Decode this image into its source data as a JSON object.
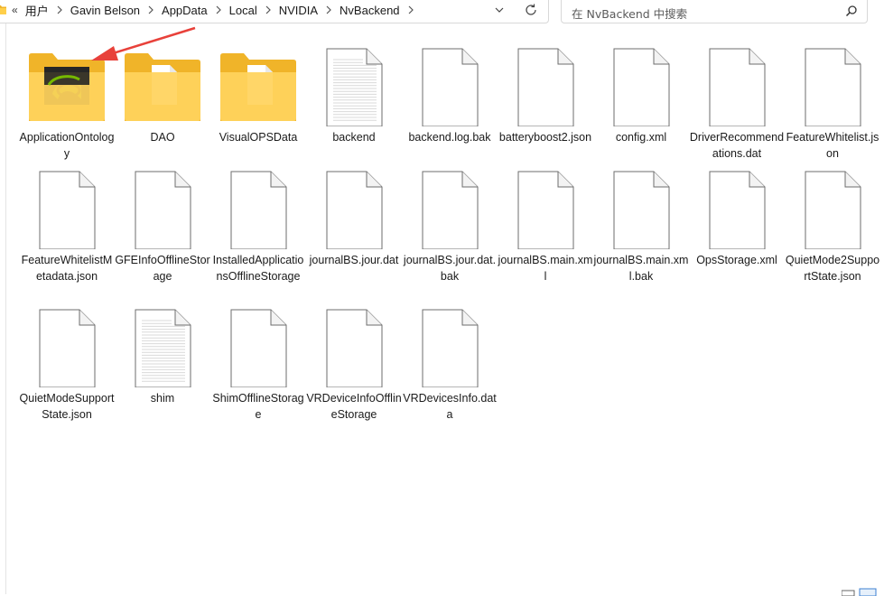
{
  "address_bar": {
    "overflow": "«",
    "crumbs": [
      "用户",
      "Gavin Belson",
      "AppData",
      "Local",
      "NVIDIA",
      "NvBackend"
    ]
  },
  "search": {
    "placeholder": "在 NvBackend 中搜索"
  },
  "items": [
    {
      "name": "ApplicationOntology",
      "kind": "folder-nvidia"
    },
    {
      "name": "DAO",
      "kind": "folder-doc"
    },
    {
      "name": "VisualOPSData",
      "kind": "folder-doc"
    },
    {
      "name": "backend",
      "kind": "file-lined"
    },
    {
      "name": "backend.log.bak",
      "kind": "file"
    },
    {
      "name": "batteryboost2.json",
      "kind": "file"
    },
    {
      "name": "config.xml",
      "kind": "file"
    },
    {
      "name": "DriverRecommendations.dat",
      "kind": "file"
    },
    {
      "name": "FeatureWhitelist.json",
      "kind": "file"
    },
    {
      "name": "FeatureWhitelistMetadata.json",
      "kind": "file"
    },
    {
      "name": "GFEInfoOfflineStorage",
      "kind": "file"
    },
    {
      "name": "InstalledApplicationsOfflineStorage",
      "kind": "file"
    },
    {
      "name": "journalBS.jour.dat",
      "kind": "file"
    },
    {
      "name": "journalBS.jour.dat.bak",
      "kind": "file"
    },
    {
      "name": "journalBS.main.xml",
      "kind": "file"
    },
    {
      "name": "journalBS.main.xml.bak",
      "kind": "file"
    },
    {
      "name": "OpsStorage.xml",
      "kind": "file"
    },
    {
      "name": "QuietMode2SupportState.json",
      "kind": "file"
    },
    {
      "name": "QuietModeSupportState.json",
      "kind": "file"
    },
    {
      "name": "shim",
      "kind": "file-lined"
    },
    {
      "name": "ShimOfflineStorage",
      "kind": "file"
    },
    {
      "name": "VRDeviceInfoOfflineStorage",
      "kind": "file"
    },
    {
      "name": "VRDevicesInfo.data",
      "kind": "file"
    }
  ],
  "colors": {
    "folder_back": "#f0b429",
    "folder_front": "#ffd35c",
    "nvidia_green": "#76b900",
    "annotation_arrow": "#e8413a"
  },
  "annotation": {
    "type": "arrow",
    "points_to_item": "ApplicationOntology"
  }
}
